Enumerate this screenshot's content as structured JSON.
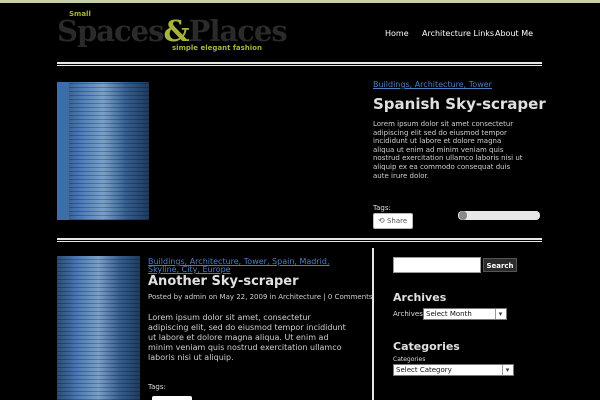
{
  "site": {
    "logo_small": "Small",
    "logo_word1": "Spaces",
    "logo_amp": "&",
    "logo_word2": "Places",
    "logo_tagline": "simple elegant fashion"
  },
  "nav": {
    "home": "Home",
    "item2": "Architecture Links",
    "item3": "About Me"
  },
  "post1": {
    "category": "Buildings, Architecture, Tower",
    "title": "Spanish Sky-scraper",
    "body": "Lorem ipsum dolor sit amet consectetur adipiscing elit sed do eiusmod tempor incididunt ut labore et dolore magna aliqua ut enim ad minim veniam quis nostrud exercitation ullamco laboris nisi ut aliquip ex ea commodo consequat duis aute irure dolor.",
    "tags_label": "Tags: ",
    "share_label": "Share"
  },
  "post2": {
    "category": "Buildings, Architecture, Tower, Spain, Madrid, Skyline, City, Europe",
    "title": "Another Sky-scraper",
    "meta": "Posted by admin on May 22, 2009 in Architecture | 0 Comments",
    "body": "Lorem ipsum dolor sit amet, consectetur adipiscing elit, sed do eiusmod tempor incididunt ut labore et dolore magna aliqua. Ut enim ad minim veniam quis nostrud exercitation ullamco laboris nisi ut aliquip.",
    "tags_label": "Tags:"
  },
  "sidebar": {
    "search_placeholder": "",
    "search_button": "Search",
    "archives_title": "Archives",
    "archives_label": "Archives",
    "archives_select": "Select Month",
    "categories_title": "Categories",
    "categories_label": "Categories",
    "categories_select": "Select Category"
  }
}
